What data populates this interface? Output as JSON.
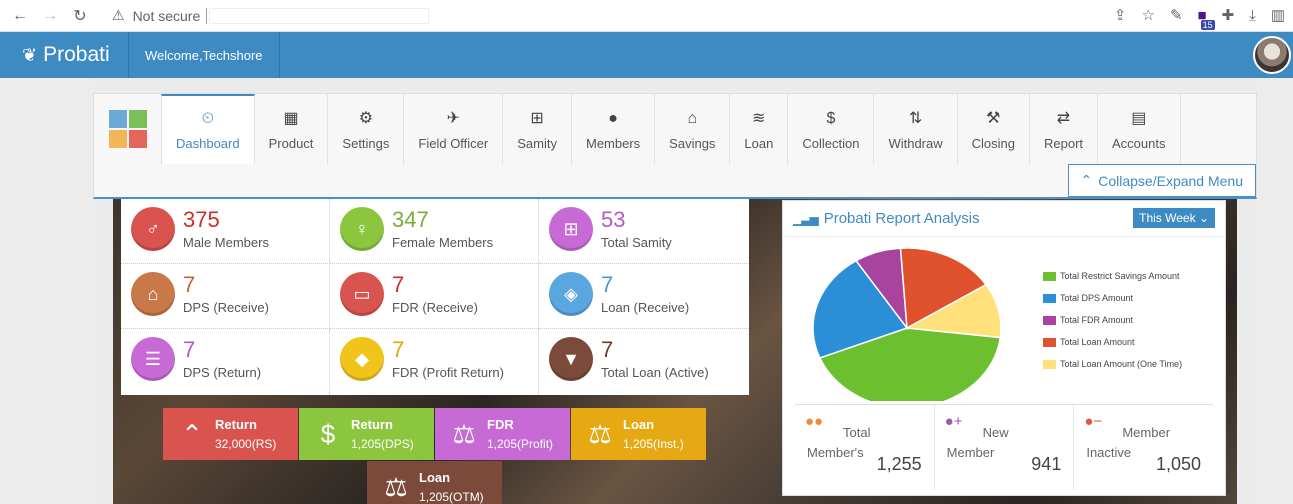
{
  "browser": {
    "address_warning": "Not secure",
    "extension_badge": "15"
  },
  "header": {
    "brand": "Probati",
    "welcome": "Welcome,Techshore"
  },
  "menu": {
    "items": [
      {
        "label": "Dashboard",
        "icon": "⏲"
      },
      {
        "label": "Product",
        "icon": "▦"
      },
      {
        "label": "Settings",
        "icon": "⚙"
      },
      {
        "label": "Field Officer",
        "icon": "✈"
      },
      {
        "label": "Samity",
        "icon": "⊞"
      },
      {
        "label": "Members",
        "icon": "●"
      },
      {
        "label": "Savings",
        "icon": "⌂"
      },
      {
        "label": "Loan",
        "icon": "≋"
      },
      {
        "label": "Collection",
        "icon": "$"
      },
      {
        "label": "Withdraw",
        "icon": "⇅"
      },
      {
        "label": "Closing",
        "icon": "⚒"
      },
      {
        "label": "Report",
        "icon": "⇄"
      },
      {
        "label": "Accounts",
        "icon": "▤"
      }
    ],
    "collapse_label": "Collapse/Expand Menu"
  },
  "stats": [
    {
      "num": "375",
      "label": "Male Members",
      "color": "#d9534f",
      "num_color": "#c9302c",
      "icon": "♂"
    },
    {
      "num": "347",
      "label": "Female Members",
      "color": "#8cc63f",
      "num_color": "#7aad34",
      "icon": "♀"
    },
    {
      "num": "53",
      "label": "Total Samity",
      "color": "#c86ad6",
      "num_color": "#b35ac3",
      "icon": "⊞"
    },
    {
      "num": "7",
      "label": "DPS (Receive)",
      "color": "#c9784a",
      "num_color": "#b9683c",
      "icon": "⌂"
    },
    {
      "num": "7",
      "label": "FDR (Receive)",
      "color": "#d9534f",
      "num_color": "#c9302c",
      "icon": "▭"
    },
    {
      "num": "7",
      "label": "Loan (Receive)",
      "color": "#5aa6df",
      "num_color": "#4b96cf",
      "icon": "◈"
    },
    {
      "num": "7",
      "label": "DPS (Return)",
      "color": "#c86ad6",
      "num_color": "#b35ac3",
      "icon": "☰"
    },
    {
      "num": "7",
      "label": "FDR (Profit Return)",
      "color": "#f0c419",
      "num_color": "#d7ab05",
      "icon": "◆"
    },
    {
      "num": "7",
      "label": "Total Loan (Active)",
      "color": "#7b4a3a",
      "num_color": "#6b3b2c",
      "icon": "▼"
    }
  ],
  "tiles": [
    {
      "title": "Return",
      "value": "32,000(RS)",
      "color": "#d9534f",
      "icon": "⌃"
    },
    {
      "title": "Return",
      "value": "1,205(DPS)",
      "color": "#8cc63f",
      "icon": "$"
    },
    {
      "title": "FDR",
      "value": "1,205(Profit)",
      "color": "#c86ad6",
      "icon": "⚖"
    },
    {
      "title": "Loan",
      "value": "1,205(Inst.)",
      "color": "#e6a913",
      "icon": "⚖"
    },
    {
      "title": "Loan",
      "value": "1,205(OTM)",
      "color": "#7b4a3a",
      "icon": "⚖"
    }
  ],
  "report": {
    "title": "Probati Report Analysis",
    "period": "This Week",
    "footer": [
      {
        "l1": "Total",
        "l2": "Member's",
        "value": "1,255",
        "icon_color": "#f08a3c",
        "icon": "●●"
      },
      {
        "l1": "New",
        "l2": "Member",
        "value": "941",
        "icon_color": "#9b59b6",
        "icon": "●+"
      },
      {
        "l1": "Member",
        "l2": "Inactive",
        "value": "1,050",
        "icon_color": "#e05a3a",
        "icon": "●−"
      }
    ]
  },
  "chart_data": {
    "type": "pie",
    "title": "",
    "slices": [
      {
        "name": "Total Restrict Savings Amount",
        "value": 42,
        "color": "#6cbf2e"
      },
      {
        "name": "Total DPS Amount",
        "value": 22,
        "color": "#2a8fd6"
      },
      {
        "name": "Total FDR Amount",
        "value": 8,
        "color": "#a9449e"
      },
      {
        "name": "Total Loan Amount",
        "value": 17,
        "color": "#e0522d"
      },
      {
        "name": "Total Loan Amount (One Time)",
        "value": 11,
        "color": "#ffe07a"
      }
    ]
  }
}
